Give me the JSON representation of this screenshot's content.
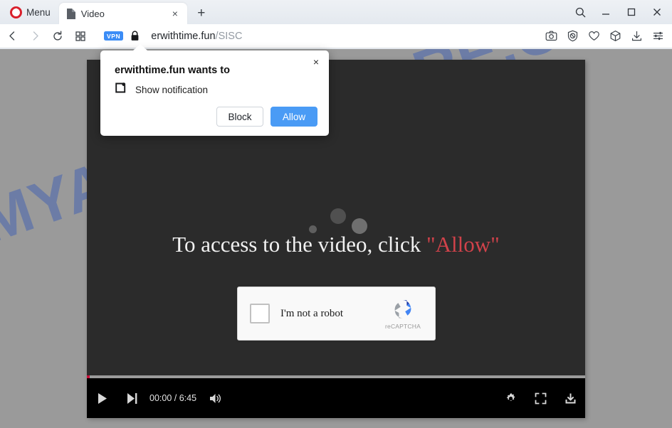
{
  "browser": {
    "menu_label": "Menu",
    "opera_logo_color": "#d9202c",
    "tab": {
      "title": "Video",
      "favicon": "document-icon",
      "close": "×"
    },
    "new_tab": "+",
    "window_controls": [
      {
        "name": "search",
        "glyph": "search-icon"
      },
      {
        "name": "minimize",
        "glyph": "minimize-icon"
      },
      {
        "name": "maximize",
        "glyph": "maximize-icon"
      },
      {
        "name": "close",
        "glyph": "close-icon"
      }
    ],
    "nav": {
      "back": "back-arrow-icon",
      "forward": "forward-arrow-icon",
      "reload": "reload-icon",
      "tab_grid": "tab-grid-icon"
    },
    "vpn_badge": "VPN",
    "vpn_badge_color": "#3b8cf6",
    "lock": "padlock-icon",
    "url_host": "erwithtime.fun",
    "url_path": "/SISC",
    "address_icons": [
      "camera-icon",
      "shield-block-icon",
      "heart-icon",
      "cube-wallet-icon",
      "download-icon",
      "easy-setup-sliders-icon"
    ]
  },
  "page": {
    "background_color": "#9a9a9a",
    "watermark": "MYANTISPYWARE.COM",
    "watermark_color": "#2d55b8"
  },
  "video": {
    "background_color": "#2b2b2b",
    "headline_prefix": "To access to the video, click ",
    "headline_allow": "\"Allow\"",
    "headline_allow_color": "#d0424a",
    "recaptcha": {
      "label": "I'm not a robot",
      "brand": "reCAPTCHA",
      "checkbox_checked": false
    },
    "controls": {
      "play": "play-icon",
      "next": "next-track-icon",
      "time": "00:00 / 6:45",
      "current_time": "00:00",
      "duration": "6:45",
      "volume": "volume-icon",
      "settings": "gear-icon",
      "fullscreen": "fullscreen-icon",
      "download": "download-icon",
      "progress_percent": 0
    }
  },
  "notification_popup": {
    "title": "erwithtime.fun wants to",
    "permission_icon": "notification-bell-icon",
    "permission": "Show notifications",
    "block_label": "Block",
    "allow_label": "Allow",
    "allow_color": "#4a9bf5",
    "close": "×"
  }
}
